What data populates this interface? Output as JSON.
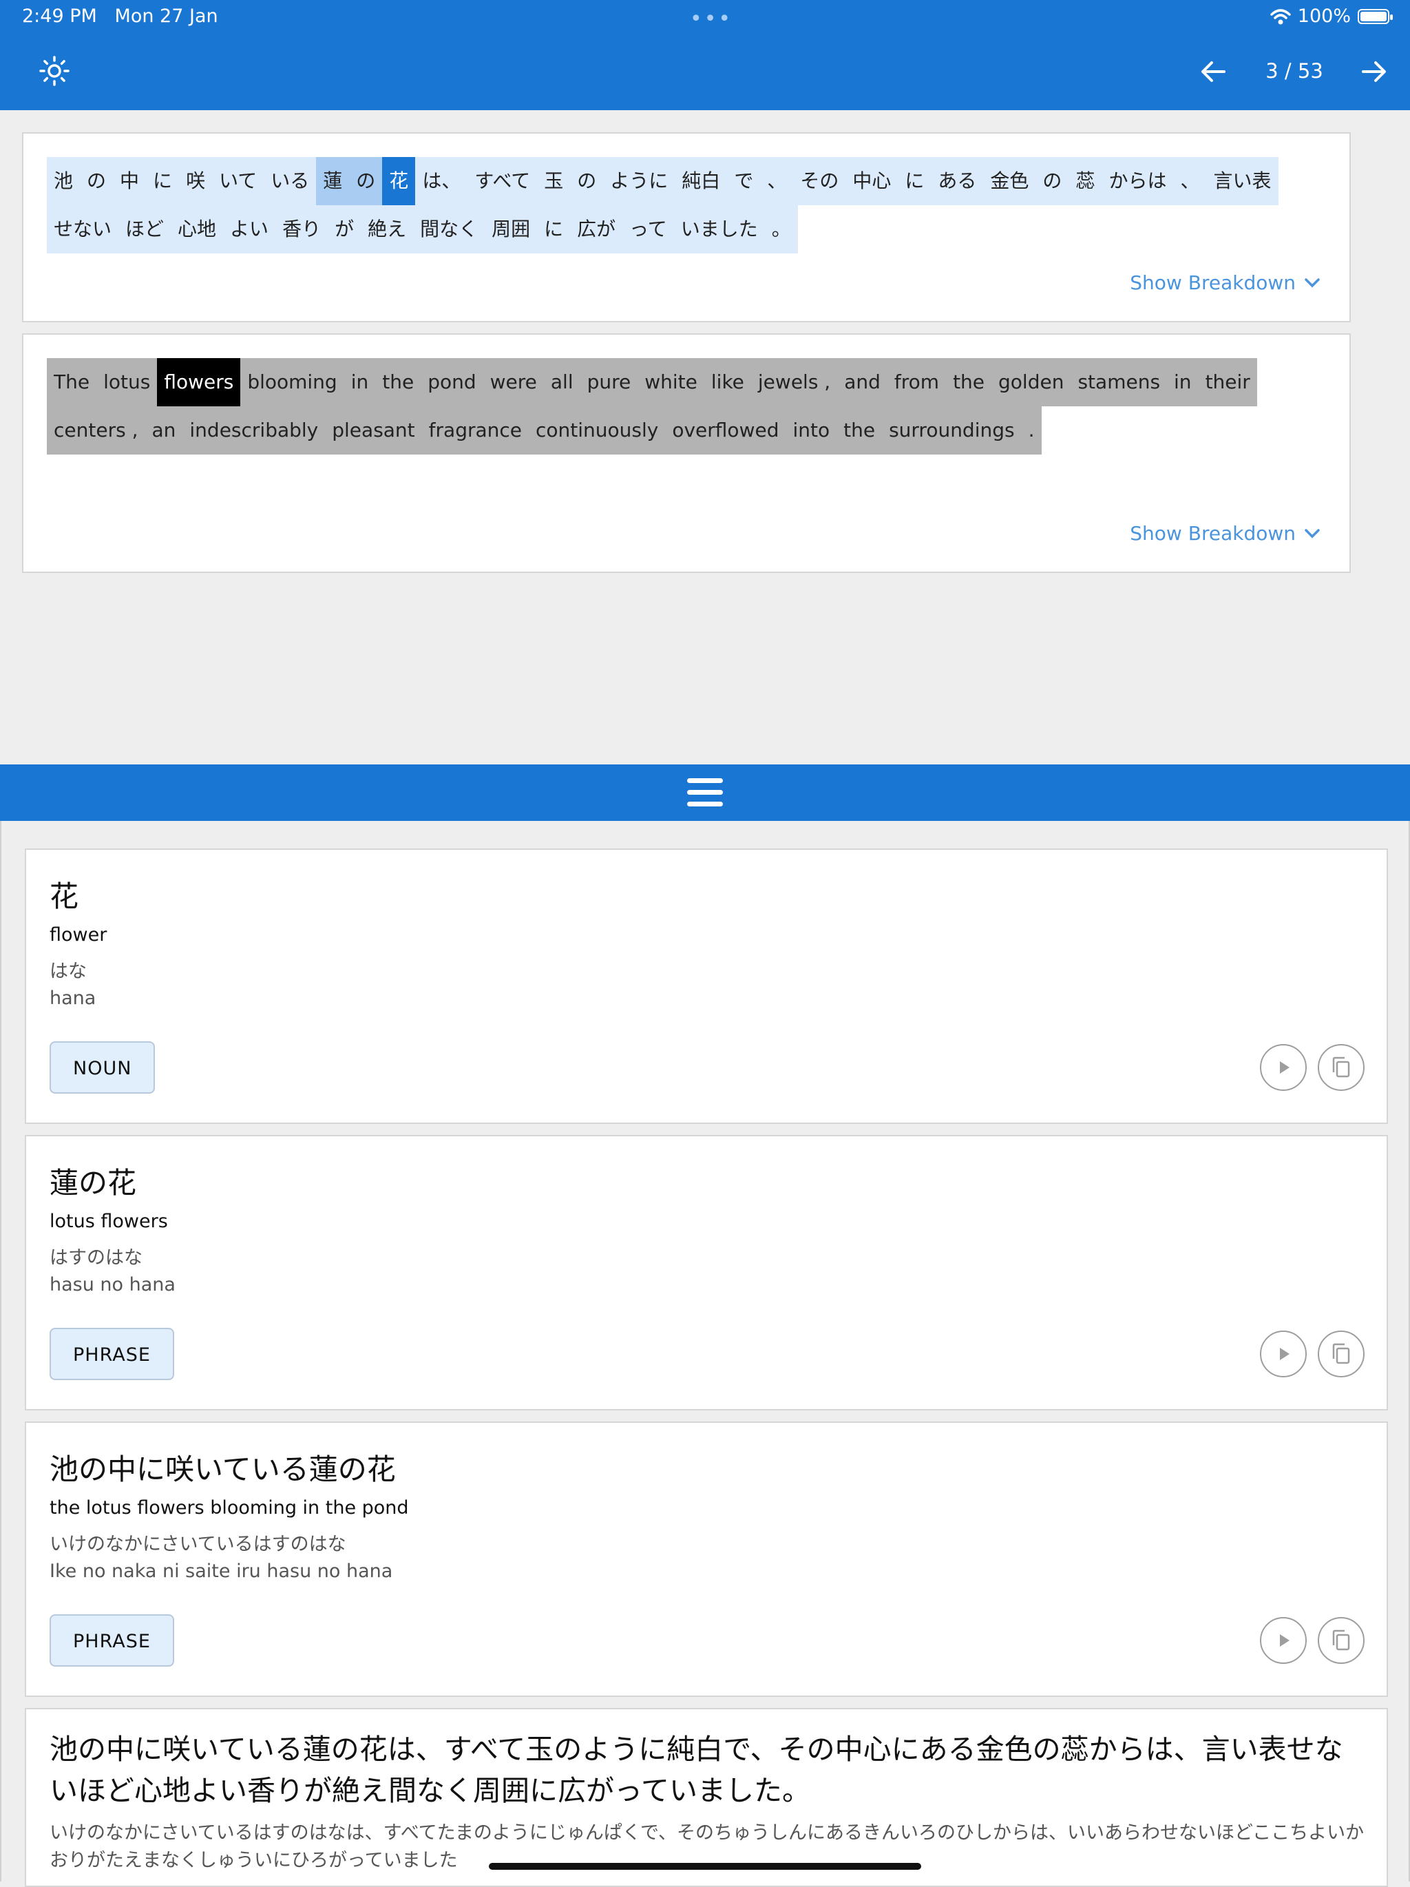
{
  "status_bar": {
    "time": "2:49 PM",
    "date": "Mon 27 Jan",
    "battery": "100%"
  },
  "header": {
    "page_indicator": "3 / 53",
    "theme_icon": "sun-icon",
    "prev_icon": "arrow-left-icon",
    "next_icon": "arrow-right-icon"
  },
  "japanese_sentence": {
    "tokens": [
      "池",
      "の",
      "中",
      "に",
      "咲",
      "いて",
      "いる",
      "蓮",
      "の",
      "花",
      "は、",
      "すべて",
      "玉",
      "の",
      "ように",
      "純白",
      "で",
      "、",
      "その",
      "中心",
      "に",
      "ある",
      "金色",
      "の",
      "蕊",
      "からは",
      "、",
      "言い表",
      "せない",
      "ほど",
      "心地",
      "よい",
      "香り",
      "が",
      "絶え",
      "間なく",
      "周囲",
      "に",
      "広が",
      "って",
      "いました",
      "。"
    ],
    "show_breakdown": "Show Breakdown"
  },
  "english_sentence": {
    "tokens": [
      "The",
      "lotus",
      "flowers",
      "blooming",
      "in",
      "the",
      "pond",
      "were",
      "all",
      "pure",
      "white",
      "like",
      "jewels ,",
      "and",
      "from",
      "the",
      "golden",
      "stamens",
      "in",
      "their",
      "centers ,",
      "an",
      "indescribably",
      "pleasant",
      "fragrance",
      "continuously",
      "overflowed",
      "into",
      "the",
      "surroundings",
      "."
    ],
    "show_breakdown": "Show Breakdown"
  },
  "drag_handle_icon": "menu-icon",
  "word_cards": [
    {
      "term": "花",
      "meaning": "flower",
      "kana": "はな",
      "romaji": "hana",
      "pos": "NOUN"
    },
    {
      "term": "蓮の花",
      "meaning": "lotus flowers",
      "kana": "はすのはな",
      "romaji": "hasu no hana",
      "pos": "PHRASE"
    },
    {
      "term": "池の中に咲いている蓮の花",
      "meaning": "the lotus flowers blooming in the pond",
      "kana": "いけのなかにさいているはすのはな",
      "romaji": "Ike no naka ni saite iru hasu no hana",
      "pos": "PHRASE"
    }
  ],
  "full_sentence": {
    "japanese": "池の中に咲いている蓮の花は、すべて玉のように純白で、その中心にある金色の蕊からは、言い表せないほど心地よい香りが絶え間なく周囲に広がっていました。",
    "kana": "いけのなかにさいているはすのはなは、すべてたまのようにじゅんぱくで、そのちゅうしんにあるきんいろのひしからは、いいあらわせないほどここちよいかおりがたえまなくしゅういにひろがっていました"
  },
  "colors": {
    "primary": "#1976d2",
    "link": "#4a94de",
    "token_bg": "#dcebfb",
    "token_phrase": "#a9cdf2",
    "en_token_bg": "#b3b3b3"
  }
}
